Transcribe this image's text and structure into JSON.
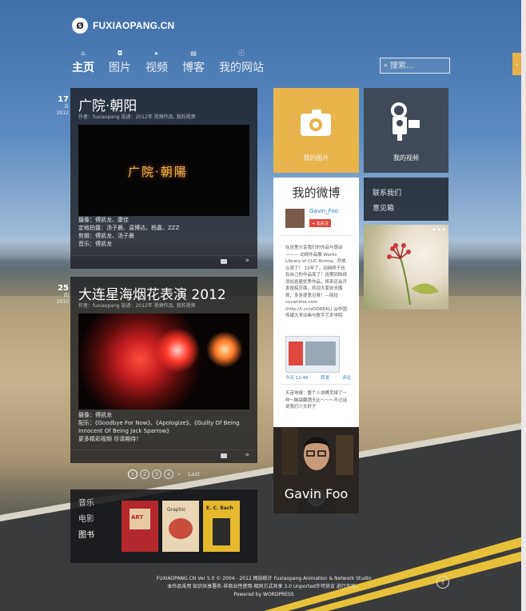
{
  "site": {
    "logo_text": "FUXIAOPANG.CN",
    "logo_badge": "Ø"
  },
  "nav": [
    {
      "label": "主页",
      "icon": "home-icon",
      "glyph": "⌂"
    },
    {
      "label": "图片",
      "icon": "camera-icon",
      "glyph": "◘"
    },
    {
      "label": "视频",
      "icon": "video-icon",
      "glyph": "▸"
    },
    {
      "label": "博客",
      "icon": "document-icon",
      "glyph": "▤"
    },
    {
      "label": "我的网站",
      "icon": "info-icon",
      "glyph": "ⓘ"
    }
  ],
  "search": {
    "placeholder": "搜索..."
  },
  "posts": [
    {
      "day": "17",
      "month": "五",
      "year": "2012",
      "title": "广院·朝阳",
      "meta": "作者：fuxiaopang 投递：2012年 视频作品, 我的视频",
      "media_caption": "广院·朝陽",
      "desc": [
        "摄像：傅凯龙、康佳",
        "定格拍摄：汤子晨、温博达、杨嘉、ZZZ",
        "剪辑：傅凯龙、汤子晨",
        "音乐：傅凯龙"
      ]
    },
    {
      "day": "25",
      "month": "四",
      "year": "2012",
      "title": "大连星海烟花表演 2012",
      "meta": "作者：fuxiaopang 投递：2012年 视频作品, 我的视频",
      "desc": [
        "摄像：傅凯龙",
        "配乐：《Goodbye For Now》、《Apologize》、《Guilty Of Being",
        "Innocent Of Being Jack Sparrow》",
        "更多精彩视频 尽请期待！"
      ]
    }
  ],
  "pagination": {
    "pages": [
      "1",
      "2",
      "3",
      "4"
    ],
    "ellipsis": "»",
    "last": "Last"
  },
  "books": {
    "tabs": [
      "音乐",
      "电影",
      "图书"
    ],
    "active": 2,
    "covers": [
      {
        "text": "ART",
        "colors": [
          "#b3282d",
          "#e8c9a0"
        ]
      },
      {
        "text": "Graphic",
        "colors": [
          "#e9d6b4",
          "#c94d3a"
        ]
      },
      {
        "text": "E. C. Bach",
        "colors": [
          "#e6b92c",
          "#2b2b2b"
        ]
      }
    ]
  },
  "tiles": {
    "photos_label": "我的图片",
    "videos_label": "我的视频",
    "photos_color": "#e9b44c",
    "videos_color": "#3f4957"
  },
  "weibo": {
    "title": "我的微博",
    "name": "Gavin_Foo",
    "follow": "+ 加关注",
    "body": "在这里分享我们的作品与感动——— 动网作品展 Works Library of CUC Anima。开放公测了！ 10年了，动网终于也有自己的作品库了！这期间陆续添加各届优秀作品，将来还会开发投稿页面，欢迎大家前去围观，多多提意见呀！—网址 cucanima.com (http://t.cn/zOD6EAL) @中国传媒大学动画与数字艺术学院",
    "time": "今天 11:46",
    "repost": "转发",
    "comment": "评论",
    "body2": "天苗地啵：整个人烧赛芜掉了一样～脑袋翻涌无比～～～不过话说我们少头好子"
  },
  "contact": {
    "links": [
      "联系我们",
      "意见箱"
    ]
  },
  "profile": {
    "name": "Gavin Foo"
  },
  "footer": {
    "line1": "FUXIAOPANG.CN Ver 5.0 © 2004 - 2012 网站统计  Fuxiaopang Animation & Network Studio",
    "line2": "本作品采用 知识共享署名-非商业性使用-相同方式共享 3.0 Unported许可协议 进行许可。",
    "line3": "Powered by WORDPRESS"
  }
}
